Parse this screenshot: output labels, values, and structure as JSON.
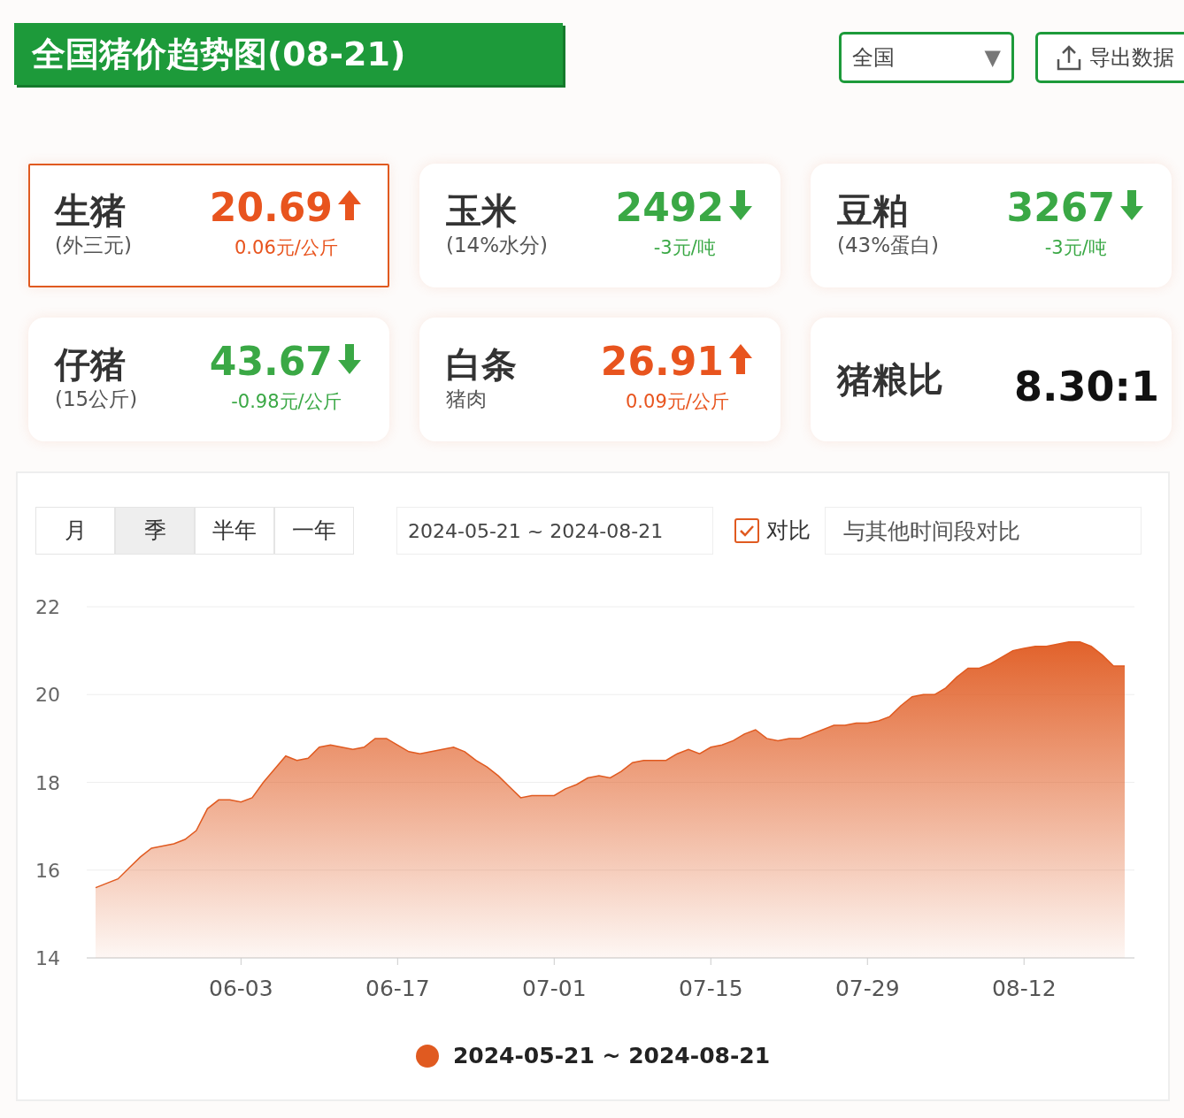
{
  "header": {
    "title": "全国猪价趋势图(08-21)",
    "region_select": {
      "value": "全国",
      "caret": "▼"
    },
    "export_button": "导出数据"
  },
  "cards": [
    {
      "name": "生猪",
      "sub": "(外三元)",
      "value": "20.69",
      "change": "0.06元/公斤",
      "kind": "up",
      "selected": true
    },
    {
      "name": "玉米",
      "sub": "(14%水分)",
      "value": "2492",
      "change": "-3元/吨",
      "kind": "down",
      "selected": false
    },
    {
      "name": "豆粕",
      "sub": "(43%蛋白)",
      "value": "3267",
      "change": "-3元/吨",
      "kind": "down",
      "selected": false
    },
    {
      "name": "仔猪",
      "sub": "(15公斤)",
      "value": "43.67",
      "change": "-0.98元/公斤",
      "kind": "down",
      "selected": false
    },
    {
      "name": "白条",
      "sub": "猪肉",
      "value": "26.91",
      "change": "0.09元/公斤",
      "kind": "up",
      "selected": false
    },
    {
      "name": "猪粮比",
      "value": "8.30:1",
      "kind": "ratio",
      "selected": false
    }
  ],
  "period_tabs": [
    {
      "label": "月",
      "selected": false
    },
    {
      "label": "季",
      "selected": true
    },
    {
      "label": "半年",
      "selected": false
    },
    {
      "label": "一年",
      "selected": false
    }
  ],
  "date_range": "2024-05-21 ~ 2024-08-21",
  "compare": {
    "label": "对比",
    "checked": true,
    "placeholder": "与其他时间段对比"
  },
  "chart_data": {
    "type": "area",
    "grid": true,
    "ylim": [
      14,
      22
    ],
    "yticks": [
      14,
      16,
      18,
      20,
      22
    ],
    "categories": [
      null,
      null,
      null,
      null,
      null,
      null,
      null,
      null,
      null,
      null,
      null,
      null,
      null,
      "06-03",
      null,
      null,
      null,
      null,
      null,
      null,
      null,
      null,
      null,
      null,
      null,
      null,
      null,
      "06-17",
      null,
      null,
      null,
      null,
      null,
      null,
      null,
      null,
      null,
      null,
      null,
      null,
      null,
      "07-01",
      null,
      null,
      null,
      null,
      null,
      null,
      null,
      null,
      null,
      null,
      null,
      null,
      null,
      "07-15",
      null,
      null,
      null,
      null,
      null,
      null,
      null,
      null,
      null,
      null,
      null,
      null,
      null,
      "07-29",
      null,
      null,
      null,
      null,
      null,
      null,
      null,
      null,
      null,
      null,
      null,
      null,
      null,
      "08-12",
      null,
      null,
      null,
      null,
      null,
      null,
      null,
      null,
      null
    ],
    "series": [
      {
        "name": "2024-05-21 ~ 2024-08-21",
        "color": "#e05a20",
        "values": [
          15.6,
          15.7,
          15.8,
          16.05,
          16.3,
          16.5,
          16.55,
          16.6,
          16.7,
          16.9,
          17.4,
          17.6,
          17.6,
          17.55,
          17.65,
          18.0,
          18.3,
          18.6,
          18.5,
          18.55,
          18.8,
          18.85,
          18.8,
          18.75,
          18.8,
          19.0,
          19.0,
          18.85,
          18.7,
          18.65,
          18.7,
          18.75,
          18.8,
          18.7,
          18.5,
          18.35,
          18.15,
          17.9,
          17.65,
          17.7,
          17.7,
          17.7,
          17.85,
          17.95,
          18.1,
          18.15,
          18.1,
          18.25,
          18.45,
          18.5,
          18.5,
          18.5,
          18.65,
          18.75,
          18.65,
          18.8,
          18.85,
          18.95,
          19.1,
          19.2,
          19.0,
          18.95,
          19.0,
          19.0,
          19.1,
          19.2,
          19.3,
          19.3,
          19.35,
          19.35,
          19.4,
          19.5,
          19.75,
          19.95,
          20.0,
          20.0,
          20.15,
          20.4,
          20.6,
          20.6,
          20.7,
          20.85,
          21.0,
          21.05,
          21.1,
          21.1,
          21.15,
          21.2,
          21.2,
          21.1,
          20.9,
          20.65,
          20.65
        ]
      }
    ]
  }
}
